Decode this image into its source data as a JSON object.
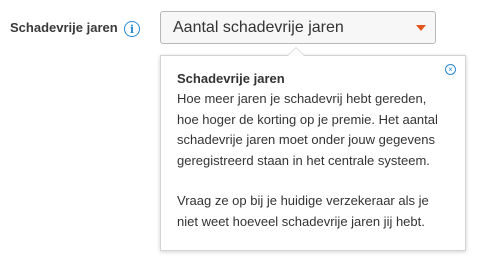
{
  "field": {
    "label": "Schadevrije jaren"
  },
  "info": {
    "icon": "info-icon",
    "glyph": "i",
    "color": "#2a8bd1"
  },
  "select": {
    "value": "Aantal schadevrije jaren",
    "caret_icon": "caret-down-icon",
    "caret_color": "#e3571f"
  },
  "tooltip": {
    "title": "Schadevrije jaren",
    "paragraph1": "Hoe meer jaren je schadevrij hebt gereden, hoe hoger de korting op je premie. Het aantal schadevrije jaren moet onder jouw gegevens geregistreerd staan in het centrale systeem.",
    "paragraph2": "Vraag ze op bij je huidige verzekeraar als je niet weet hoeveel schadevrije jaren jij hebt.",
    "close_icon": "close-icon",
    "close_glyph": "×"
  }
}
